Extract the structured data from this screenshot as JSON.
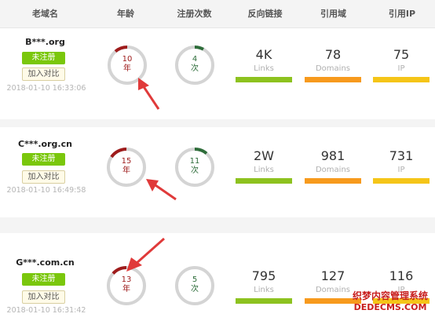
{
  "header": {
    "col_domain": "老域名",
    "col_age": "年龄",
    "col_reg": "注册次数",
    "col_backlinks": "反向链接",
    "col_refdomains": "引用域",
    "col_refip": "引用IP"
  },
  "rows": [
    {
      "domain": "B***.org",
      "status": "未注册",
      "compare": "加入对比",
      "datetime": "2018-01-10 16:33:06",
      "age": "10",
      "age_unit": "年",
      "reg": "4",
      "reg_unit": "次",
      "links": "4K",
      "links_label": "Links",
      "domains": "78",
      "domains_label": "Domains",
      "ip": "75",
      "ip_label": "IP"
    },
    {
      "domain": "C***.org.cn",
      "status": "未注册",
      "compare": "加入对比",
      "datetime": "2018-01-10 16:49:58",
      "age": "15",
      "age_unit": "年",
      "reg": "11",
      "reg_unit": "次",
      "links": "2W",
      "links_label": "Links",
      "domains": "981",
      "domains_label": "Domains",
      "ip": "731",
      "ip_label": "IP"
    },
    {
      "domain": "G***.com.cn",
      "status": "未注册",
      "compare": "加入对比",
      "datetime": "2018-01-10 16:31:42",
      "age": "13",
      "age_unit": "年",
      "reg": "5",
      "reg_unit": "次",
      "links": "795",
      "links_label": "Links",
      "domains": "127",
      "domains_label": "Domains",
      "ip": "116",
      "ip_label": "IP"
    }
  ],
  "watermark": {
    "line1": "织梦内容管理系统",
    "line2": "DEDECMS.COM"
  },
  "colors": {
    "age_ring": "#9e1b1b",
    "reg_ring": "#2e6d3a",
    "ring_track": "#d4d4d4",
    "links_bar": "#8dc21f",
    "domains_bar": "#f79a1d",
    "ip_bar": "#f5c518",
    "status_tag": "#7ac70c",
    "arrow": "#e03a3a"
  }
}
